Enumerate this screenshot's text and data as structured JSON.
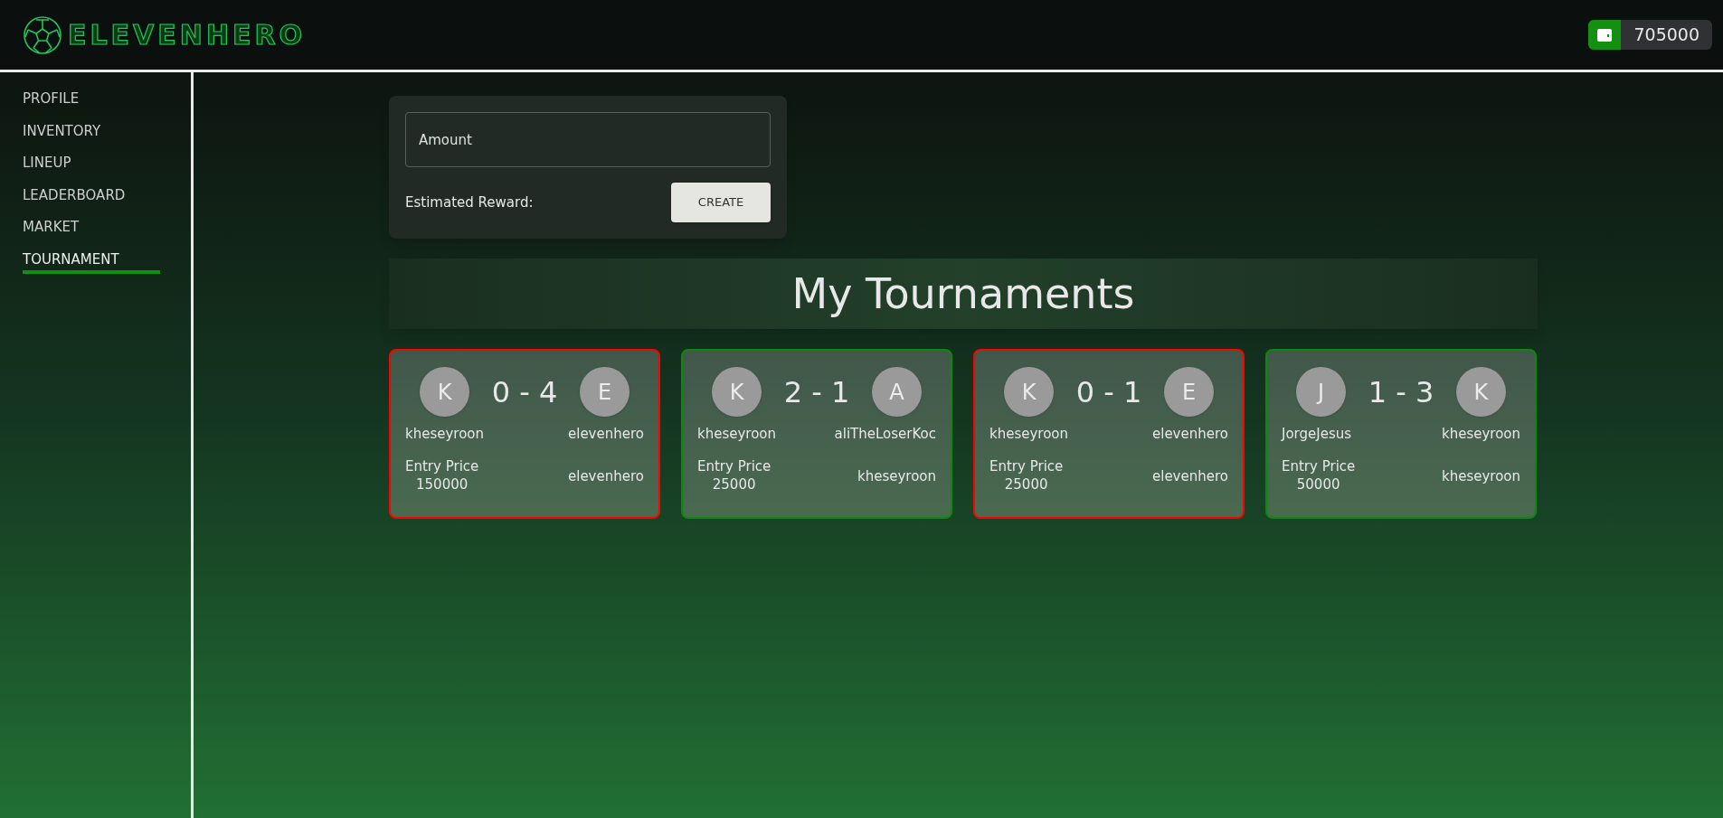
{
  "header": {
    "logo_text": "ELEVENHERO",
    "balance": "705000"
  },
  "sidebar": {
    "items": [
      {
        "label": "PROFILE",
        "selected": false
      },
      {
        "label": "INVENTORY",
        "selected": false
      },
      {
        "label": "LINEUP",
        "selected": false
      },
      {
        "label": "LEADERBOARD",
        "selected": false
      },
      {
        "label": "MARKET",
        "selected": false
      },
      {
        "label": "TOURNAMENT",
        "selected": true
      }
    ]
  },
  "create_form": {
    "amount_placeholder": "Amount",
    "reward_label": "Estimated Reward:",
    "button": "CREATE"
  },
  "section_title": "My Tournaments",
  "tournaments": [
    {
      "color": "#ff0000",
      "home_initial": "K",
      "away_initial": "E",
      "score": "0 - 4",
      "home_name": "kheseyroon",
      "away_name": "elevenhero",
      "entry_label": "Entry Price",
      "entry_price": "150000",
      "winner": "elevenhero"
    },
    {
      "color": "#0a8a0a",
      "home_initial": "K",
      "away_initial": "A",
      "score": "2 - 1",
      "home_name": "kheseyroon",
      "away_name": "aliTheLoserKoc",
      "entry_label": "Entry Price",
      "entry_price": "25000",
      "winner": "kheseyroon"
    },
    {
      "color": "#ff0000",
      "home_initial": "K",
      "away_initial": "E",
      "score": "0 - 1",
      "home_name": "kheseyroon",
      "away_name": "elevenhero",
      "entry_label": "Entry Price",
      "entry_price": "25000",
      "winner": "elevenhero"
    },
    {
      "color": "#0a8a0a",
      "home_initial": "J",
      "away_initial": "K",
      "score": "1 - 3",
      "home_name": "JorgeJesus",
      "away_name": "kheseyroon",
      "entry_label": "Entry Price",
      "entry_price": "50000",
      "winner": "kheseyroon"
    }
  ]
}
